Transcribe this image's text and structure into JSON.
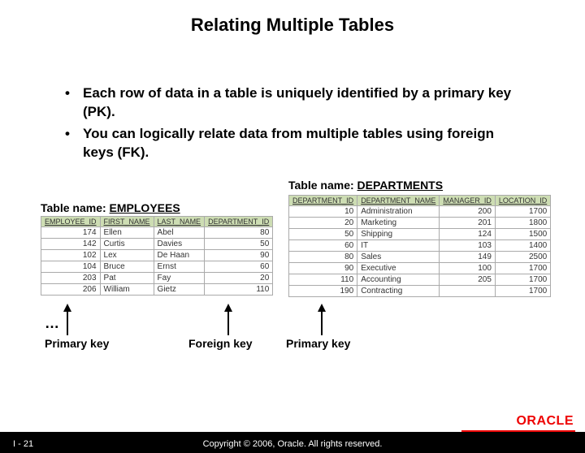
{
  "title": "Relating Multiple Tables",
  "bullets": [
    "Each row of data in a table is uniquely identified by a primary key (PK).",
    "You can logically relate data from multiple tables using foreign keys (FK)."
  ],
  "employees": {
    "caption_prefix": "Table name: ",
    "caption_name": "EMPLOYEES",
    "columns": [
      "EMPLOYEE_ID",
      "FIRST_NAME",
      "LAST_NAME",
      "DEPARTMENT_ID"
    ],
    "rows": [
      [
        "174",
        "Ellen",
        "Abel",
        "80"
      ],
      [
        "142",
        "Curtis",
        "Davies",
        "50"
      ],
      [
        "102",
        "Lex",
        "De Haan",
        "90"
      ],
      [
        "104",
        "Bruce",
        "Ernst",
        "60"
      ],
      [
        "203",
        "Pat",
        "Fay",
        "20"
      ],
      [
        "206",
        "William",
        "Gietz",
        "110"
      ]
    ]
  },
  "departments": {
    "caption_prefix": "Table name: ",
    "caption_name": "DEPARTMENTS",
    "columns": [
      "DEPARTMENT_ID",
      "DEPARTMENT_NAME",
      "MANAGER_ID",
      "LOCATION_ID"
    ],
    "rows": [
      [
        "10",
        "Administration",
        "200",
        "1700"
      ],
      [
        "20",
        "Marketing",
        "201",
        "1800"
      ],
      [
        "50",
        "Shipping",
        "124",
        "1500"
      ],
      [
        "60",
        "IT",
        "103",
        "1400"
      ],
      [
        "80",
        "Sales",
        "149",
        "2500"
      ],
      [
        "90",
        "Executive",
        "100",
        "1700"
      ],
      [
        "110",
        "Accounting",
        "205",
        "1700"
      ],
      [
        "190",
        "Contracting",
        "",
        "1700"
      ]
    ]
  },
  "ellipsis": "…",
  "key_labels": {
    "primary1": "Primary key",
    "foreign": "Foreign key",
    "primary2": "Primary key"
  },
  "footer": {
    "page": "I - 21",
    "copyright": "Copyright © 2006, Oracle. All rights reserved.",
    "logo": "ORACLE"
  }
}
